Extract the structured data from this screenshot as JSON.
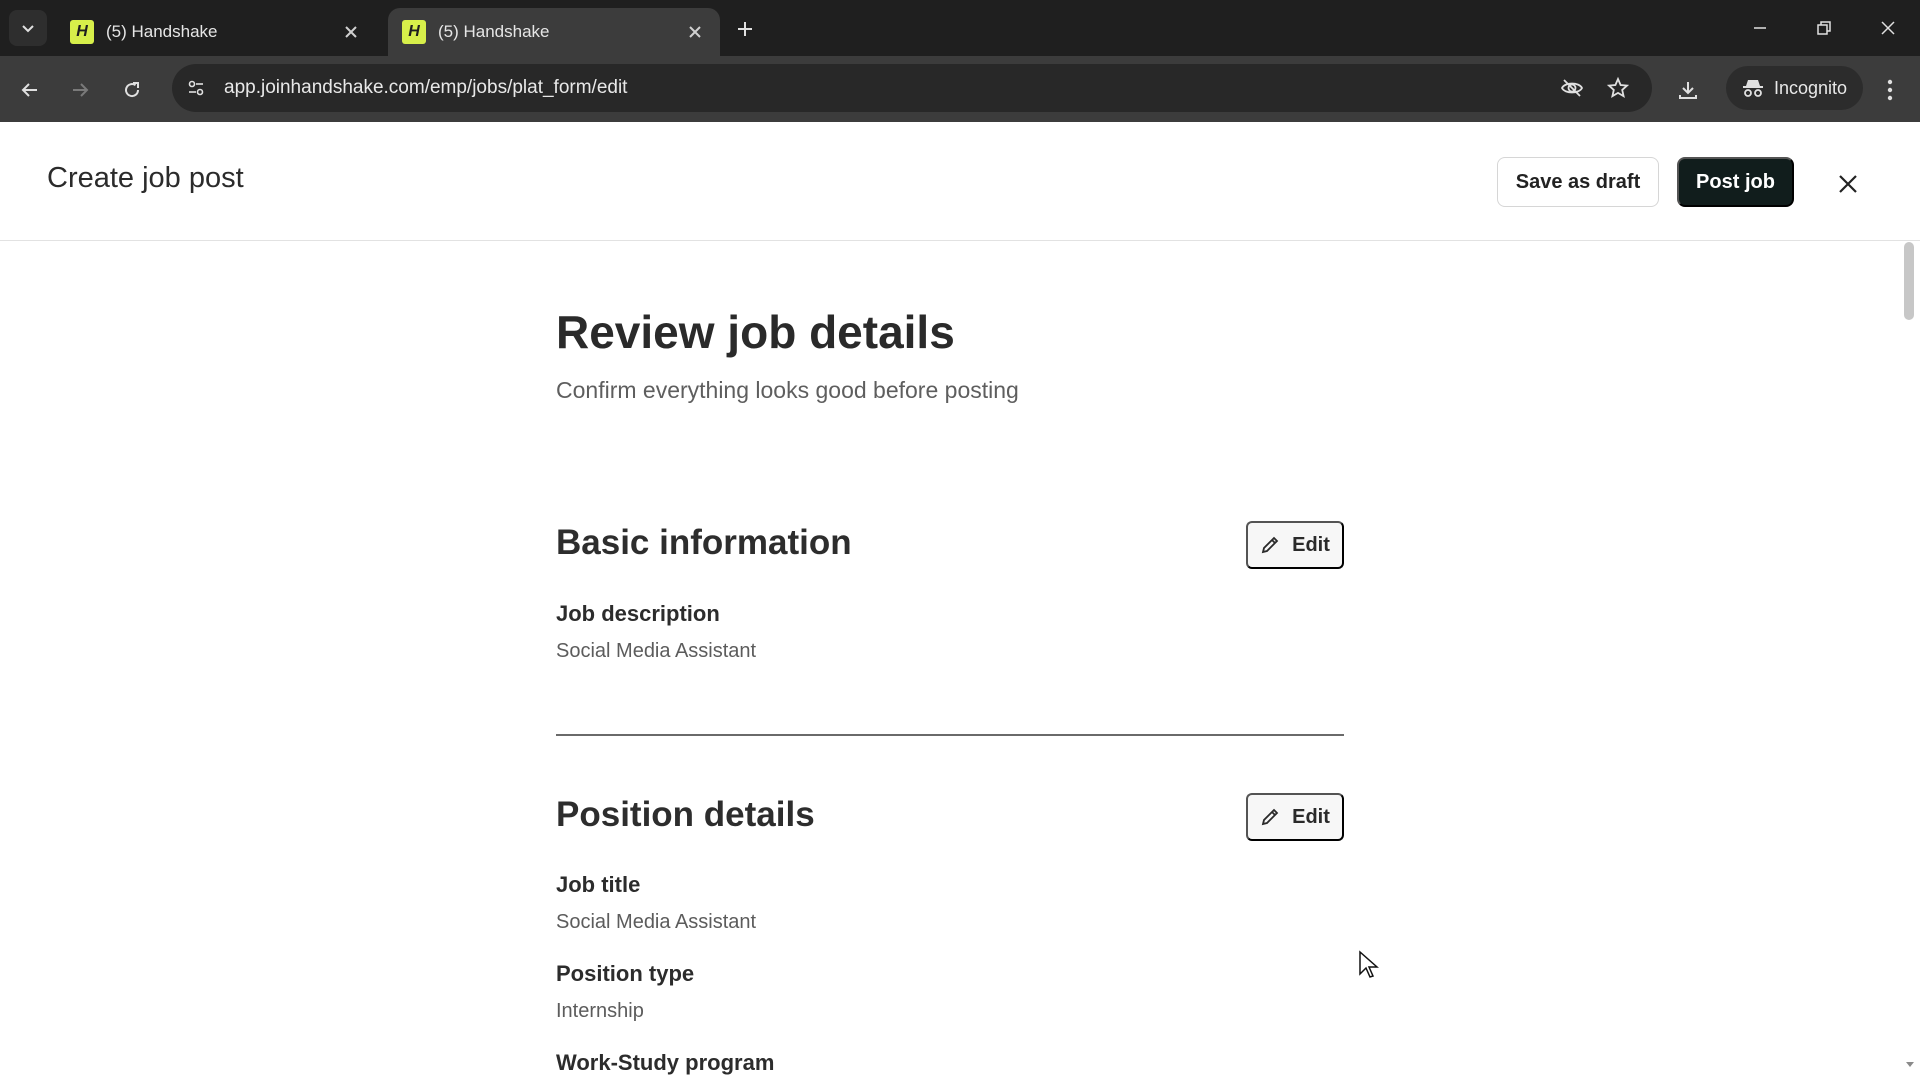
{
  "browser": {
    "tabs": [
      {
        "title": "(5) Handshake",
        "favicon": "H",
        "active": false
      },
      {
        "title": "(5) Handshake",
        "favicon": "H",
        "active": true
      }
    ],
    "url": "app.joinhandshake.com/emp/jobs/plat_form/edit",
    "incognito_label": "Incognito"
  },
  "header": {
    "title": "Create job post",
    "save_draft_label": "Save as draft",
    "post_job_label": "Post job"
  },
  "page": {
    "title": "Review job details",
    "subtitle": "Confirm everything looks good before posting"
  },
  "sections": {
    "basic": {
      "title": "Basic information",
      "edit_label": "Edit",
      "fields": [
        {
          "label": "Job description",
          "value": "Social Media Assistant"
        }
      ]
    },
    "position": {
      "title": "Position details",
      "edit_label": "Edit",
      "fields": [
        {
          "label": "Job title",
          "value": "Social Media Assistant"
        },
        {
          "label": "Position type",
          "value": "Internship"
        },
        {
          "label": "Work-Study program",
          "value": ""
        }
      ]
    }
  },
  "colors": {
    "brand_favicon": "#d7ef4a",
    "primary_button": "#111d1c"
  }
}
